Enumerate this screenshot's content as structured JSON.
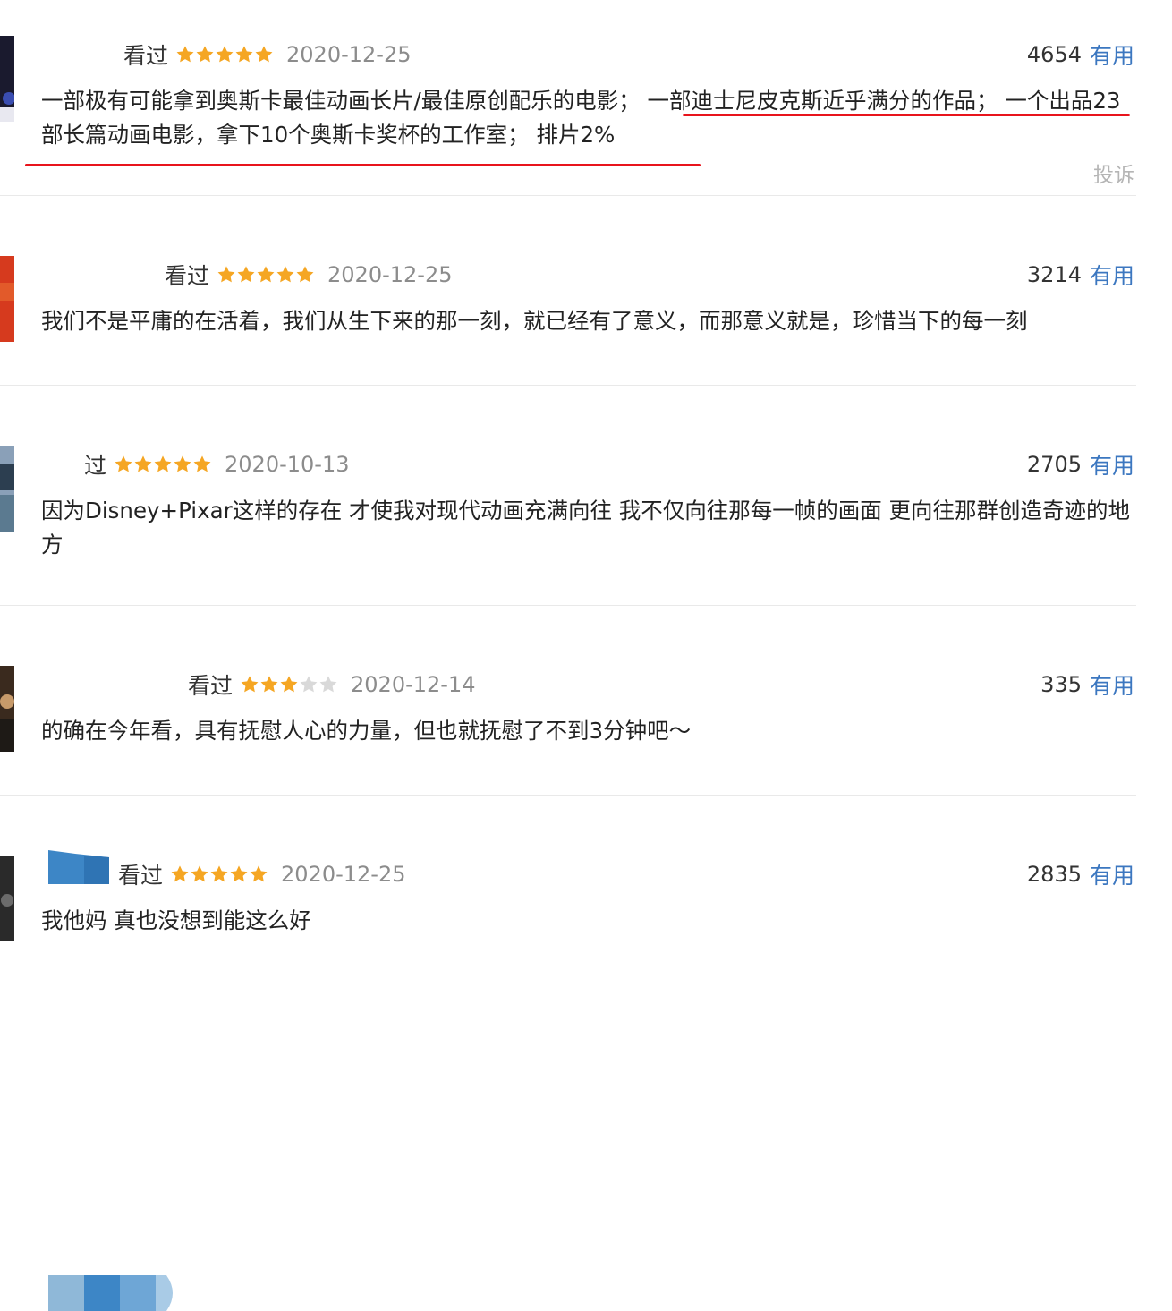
{
  "colors": {
    "star_on": "#f5a623",
    "star_off": "#d9d9d9",
    "useful_link": "#3c77c0",
    "highlight_underline": "#e8141c"
  },
  "reviews": [
    {
      "status": "看过",
      "rating": 5,
      "date": "2020-12-25",
      "votes": "4654",
      "useful_label": "有用",
      "content": "一部极有可能拿到奥斯卡最佳动画长片/最佳原创配乐的电影； 一部迪士尼皮克斯近乎满分的作品； 一个出品23部长篇动画电影，拿下10个奥斯卡奖杯的工作室； 排片2%",
      "report_label": "投诉"
    },
    {
      "status": "看过",
      "rating": 5,
      "date": "2020-12-25",
      "votes": "3214",
      "useful_label": "有用",
      "content": "我们不是平庸的在活着，我们从生下来的那一刻，就已经有了意义，而那意义就是，珍惜当下的每一刻"
    },
    {
      "status": "过",
      "rating": 5,
      "date": "2020-10-13",
      "votes": "2705",
      "useful_label": "有用",
      "content": "因为Disney+Pixar这样的存在 才使我对现代动画充满向往 我不仅向往那每一帧的画面 更向往那群创造奇迹的地方"
    },
    {
      "status": "看过",
      "rating": 3,
      "date": "2020-12-14",
      "votes": "335",
      "useful_label": "有用",
      "content": "的确在今年看，具有抚慰人心的力量，但也就抚慰了不到3分钟吧～"
    },
    {
      "status": "看过",
      "rating": 5,
      "date": "2020-12-25",
      "votes": "2835",
      "useful_label": "有用",
      "content": "我他妈 真也没想到能这么好"
    }
  ]
}
